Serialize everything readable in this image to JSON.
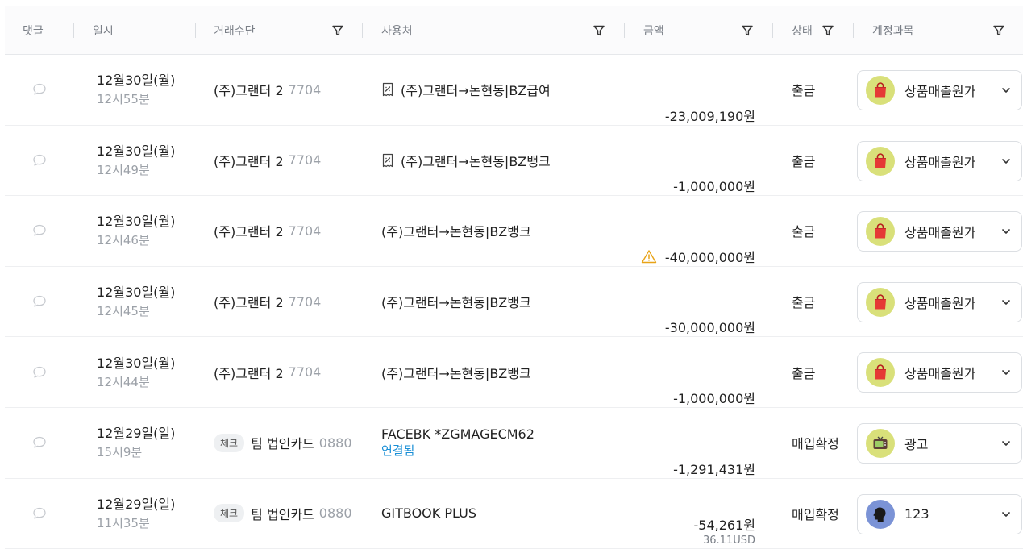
{
  "header": {
    "comment": "댓글",
    "datetime": "일시",
    "method": "거래수단",
    "merchant": "사용처",
    "amount": "금액",
    "status": "상태",
    "account": "계정과목"
  },
  "rows": [
    {
      "date": "12월30일(월)",
      "time": "12시55분",
      "chip": "",
      "method": "(주)그랜터 2",
      "last4": "7704",
      "merchant": "(주)그랜터→논현동|BZ급여",
      "receipt": true,
      "linked": "",
      "warn": false,
      "amount": "-23,009,190원",
      "usd": "",
      "status": "출금",
      "account": "상품매출원가",
      "icon": "shopping-bag-icon",
      "icon_bg": "#d9e07a"
    },
    {
      "date": "12월30일(월)",
      "time": "12시49분",
      "chip": "",
      "method": "(주)그랜터 2",
      "last4": "7704",
      "merchant": "(주)그랜터→논현동|BZ뱅크",
      "receipt": true,
      "linked": "",
      "warn": false,
      "amount": "-1,000,000원",
      "usd": "",
      "status": "출금",
      "account": "상품매출원가",
      "icon": "shopping-bag-icon",
      "icon_bg": "#d9e07a"
    },
    {
      "date": "12월30일(월)",
      "time": "12시46분",
      "chip": "",
      "method": "(주)그랜터 2",
      "last4": "7704",
      "merchant": "(주)그랜터→논현동|BZ뱅크",
      "receipt": false,
      "linked": "",
      "warn": true,
      "amount": "-40,000,000원",
      "usd": "",
      "status": "출금",
      "account": "상품매출원가",
      "icon": "shopping-bag-icon",
      "icon_bg": "#d9e07a"
    },
    {
      "date": "12월30일(월)",
      "time": "12시45분",
      "chip": "",
      "method": "(주)그랜터 2",
      "last4": "7704",
      "merchant": "(주)그랜터→논현동|BZ뱅크",
      "receipt": false,
      "linked": "",
      "warn": false,
      "amount": "-30,000,000원",
      "usd": "",
      "status": "출금",
      "account": "상품매출원가",
      "icon": "shopping-bag-icon",
      "icon_bg": "#d9e07a"
    },
    {
      "date": "12월30일(월)",
      "time": "12시44분",
      "chip": "",
      "method": "(주)그랜터 2",
      "last4": "7704",
      "merchant": "(주)그랜터→논현동|BZ뱅크",
      "receipt": false,
      "linked": "",
      "warn": false,
      "amount": "-1,000,000원",
      "usd": "",
      "status": "출금",
      "account": "상품매출원가",
      "icon": "shopping-bag-icon",
      "icon_bg": "#d9e07a"
    },
    {
      "date": "12월29일(일)",
      "time": "15시9분",
      "chip": "체크",
      "method": "팀 법인카드",
      "last4": "0880",
      "merchant": "FACEBK *ZGMAGECM62",
      "receipt": false,
      "linked": "연결됨",
      "warn": false,
      "amount": "-1,291,431원",
      "usd": "",
      "status": "매입확정",
      "account": "광고",
      "icon": "tv-icon",
      "icon_bg": "#d9e07a"
    },
    {
      "date": "12월29일(일)",
      "time": "11시35분",
      "chip": "체크",
      "method": "팀 법인카드",
      "last4": "0880",
      "merchant": "GITBOOK PLUS",
      "receipt": false,
      "linked": "",
      "warn": false,
      "amount": "-54,261원",
      "usd": "36.11USD",
      "status": "매입확정",
      "account": "123",
      "icon": "head-icon",
      "icon_bg": "#7b93d6"
    }
  ],
  "colors": {
    "accent_link": "#1a8fd6",
    "warning": "#e8a317",
    "bag": "#e53935"
  }
}
